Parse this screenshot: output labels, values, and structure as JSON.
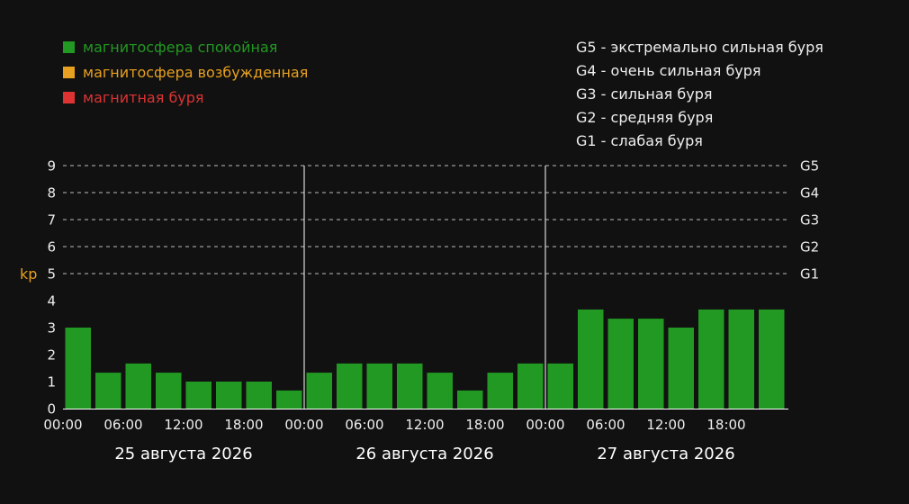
{
  "legend": [
    {
      "label": "магнитосфера спокойная",
      "color": "#229922"
    },
    {
      "label": "магнитосфера возбужденная",
      "color": "#e8a020"
    },
    {
      "label": "магнитная буря",
      "color": "#dd3333"
    }
  ],
  "g_levels": [
    {
      "code": "G5",
      "desc": "экстремально сильная буря"
    },
    {
      "code": "G4",
      "desc": "очень сильная буря"
    },
    {
      "code": "G3",
      "desc": "сильная буря"
    },
    {
      "code": "G2",
      "desc": "средняя буря"
    },
    {
      "code": "G1",
      "desc": "слабая буря"
    }
  ],
  "separator": "-",
  "chart_data": {
    "type": "bar",
    "ylabel": "kp",
    "ylim": [
      0,
      9
    ],
    "yticks": [
      0,
      1,
      2,
      3,
      4,
      5,
      6,
      7,
      8,
      9
    ],
    "grid": true,
    "right_axis_labels": [
      {
        "value": 5,
        "label": "G1"
      },
      {
        "value": 6,
        "label": "G2"
      },
      {
        "value": 7,
        "label": "G3"
      },
      {
        "value": 8,
        "label": "G4"
      },
      {
        "value": 9,
        "label": "G5"
      }
    ],
    "days": [
      {
        "label": "25 августа 2026",
        "tick_labels": [
          "00:00",
          "06:00",
          "12:00",
          "18:00"
        ],
        "values": [
          3.0,
          1.33,
          1.67,
          1.33,
          1.0,
          1.0,
          1.0,
          0.67
        ]
      },
      {
        "label": "26 августа 2026",
        "tick_labels": [
          "00:00",
          "06:00",
          "12:00",
          "18:00"
        ],
        "values": [
          1.33,
          1.67,
          1.67,
          1.67,
          1.33,
          0.67,
          1.33,
          1.67
        ]
      },
      {
        "label": "27 августа 2026",
        "tick_labels": [
          "00:00",
          "06:00",
          "12:00",
          "18:00"
        ],
        "values": [
          1.67,
          3.67,
          3.33,
          3.33,
          3.0,
          3.67,
          3.67,
          3.67
        ]
      }
    ],
    "bar_color": "#229922",
    "text_color": "#eeeeee",
    "ylabel_color": "#e8a020",
    "grid_color": "#bbbbbb"
  }
}
